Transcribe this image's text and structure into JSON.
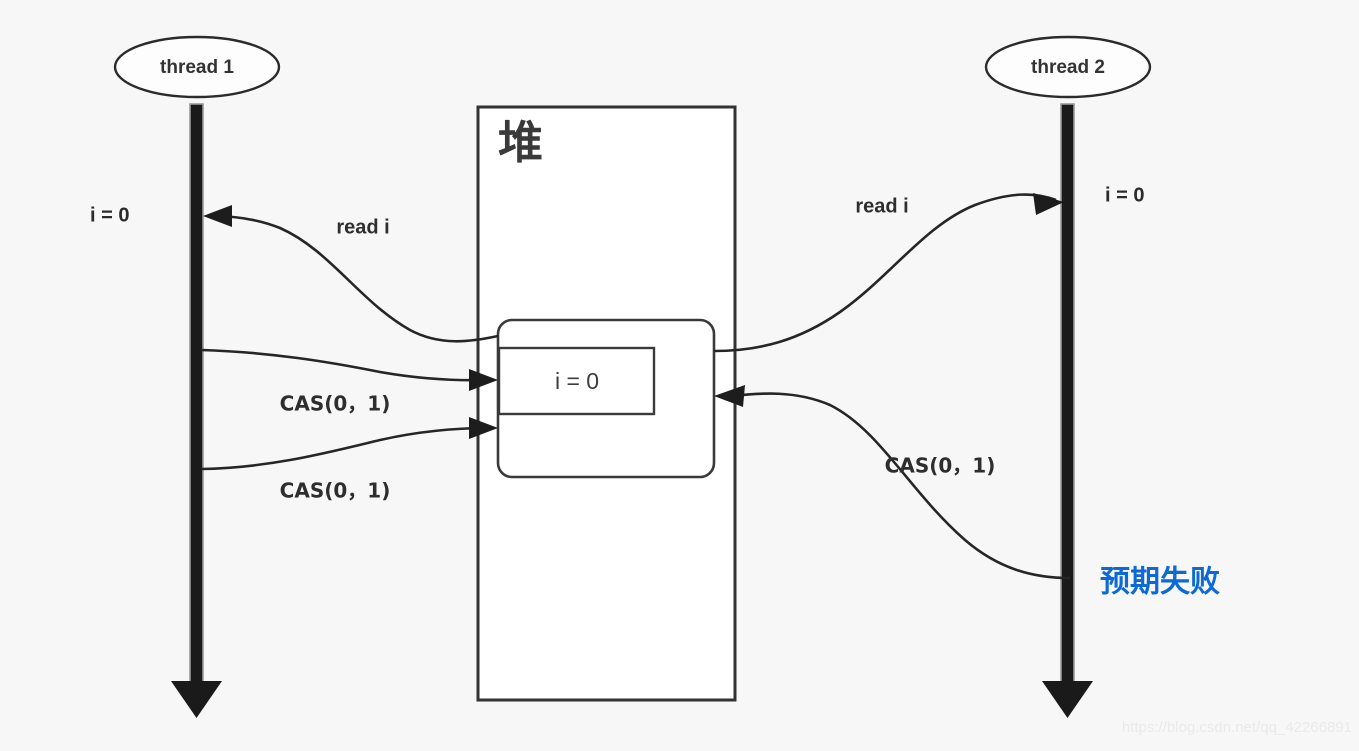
{
  "diagram": {
    "title_hidden": "",
    "background_color": "#f7f7f7",
    "ink_color": "#262626",
    "highlight_color": "#0d6ad4",
    "threads": [
      {
        "id": "thread-1",
        "label": "thread 1"
      },
      {
        "id": "thread-2",
        "label": "thread 2"
      }
    ],
    "heap": {
      "label": "堆",
      "object": {
        "field_label": "i = 0"
      }
    },
    "states": [
      {
        "id": "thread-1-state",
        "label": "i = 0"
      },
      {
        "id": "thread-2-state",
        "label": "i = 0"
      }
    ],
    "messages": [
      {
        "id": "thread-1-read",
        "label": "read i",
        "direction": "heap-to-thread-1"
      },
      {
        "id": "thread-2-read",
        "label": "read i",
        "direction": "heap-to-thread-2"
      },
      {
        "id": "thread-1-cas-a",
        "label": "CAS(0，1)",
        "direction": "thread-1-to-heap"
      },
      {
        "id": "thread-1-cas-b",
        "label": "CAS(0，1)",
        "direction": "thread-1-to-heap"
      },
      {
        "id": "thread-2-cas",
        "label": "CAS(0，1)",
        "direction": "thread-2-to-heap"
      }
    ],
    "annotations": [
      {
        "id": "expected-failure",
        "label": "预期失败",
        "color": "#0d6ad4"
      }
    ],
    "watermark": "https://blog.csdn.net/qq_42266891"
  }
}
